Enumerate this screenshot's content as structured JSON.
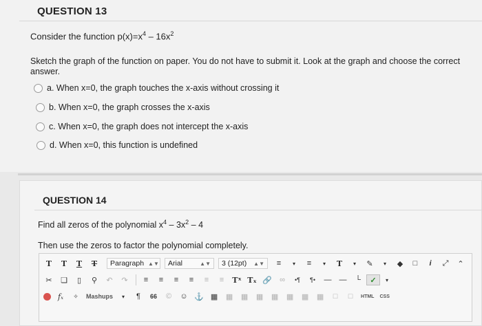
{
  "q13": {
    "title": "QUESTION 13",
    "prompt_text": "Consider the function p(x)=x",
    "prompt_exp1": "4",
    "prompt_mid": " – 16x",
    "prompt_exp2": "2",
    "instructions": "Sketch the graph of the function on paper. You do not have to submit it. Look at the graph and choose the correct answer.",
    "options": [
      "a. When x=0, the graph touches the x-axis without crossing it",
      "b. When x=0, the graph crosses the x-axis",
      "c. When x=0, the graph does not intercept the x-axis",
      "d. When x=0, this function is undefined"
    ]
  },
  "q14": {
    "title": "QUESTION 14",
    "prompt_text": "Find all zeros of the polynomial x",
    "prompt_exp1": "4",
    "prompt_mid": " – 3x",
    "prompt_exp2": "2",
    "prompt_end": " – 4",
    "instructions": "Then use the zeros to factor the polynomial completely."
  },
  "editor": {
    "row1": {
      "t1": "T",
      "t2": "T",
      "t3": "T",
      "t4": "T",
      "paragraph": "Paragraph",
      "font": "Arial",
      "size": "3 (12pt)",
      "text_color": "T"
    },
    "row2": {
      "superscript": "Tˣ",
      "subscript": "Tₓ"
    },
    "row3": {
      "fx": "fₓ",
      "mashups": "Mashups",
      "pilcrow": "¶",
      "quote": "66",
      "html": "HTML",
      "css": "CSS"
    },
    "icons": [
      "cut-icon",
      "copy-icon",
      "paste-icon",
      "find-icon",
      "undo-icon",
      "redo-icon",
      "align-left-icon",
      "align-center-icon",
      "align-right-icon",
      "justify-icon",
      "bullet-list-icon",
      "numbered-list-icon",
      "pen-icon",
      "eraser-icon",
      "spellcheck-icon",
      "fullscreen-icon",
      "info-icon",
      "expand-icon",
      "collapse-icon",
      "anchor-icon",
      "table-icon",
      "emoji-icon",
      "copyright-icon"
    ]
  }
}
